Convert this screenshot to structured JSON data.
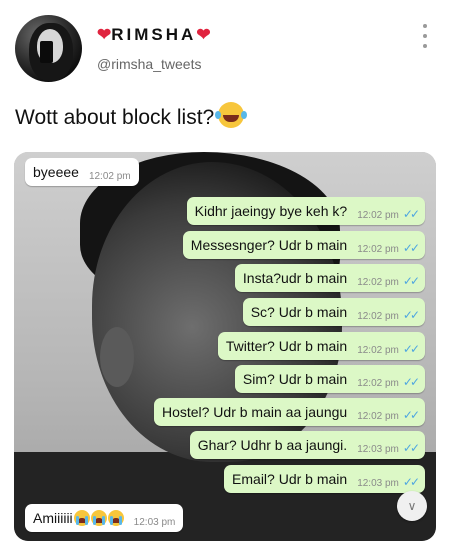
{
  "author": {
    "display_name": "RIMSHA",
    "handle": "@rimsha_tweets"
  },
  "tweet": {
    "text": "Wott about block list?",
    "emoji": "face-with-tears-of-joy"
  },
  "chat": {
    "messages": [
      {
        "side": "in",
        "text": "byeeee",
        "time": "12:02 pm"
      },
      {
        "side": "out",
        "text": "Kidhr jaeingy bye keh k?",
        "time": "12:02 pm",
        "ticks": "✓✓"
      },
      {
        "side": "out",
        "text": "Messesnger? Udr b main",
        "time": "12:02 pm",
        "ticks": "✓✓"
      },
      {
        "side": "out",
        "text": "Insta?udr b main",
        "time": "12:02 pm",
        "ticks": "✓✓"
      },
      {
        "side": "out",
        "text": "Sc? Udr b main",
        "time": "12:02 pm",
        "ticks": "✓✓"
      },
      {
        "side": "out",
        "text": "Twitter? Udr b main",
        "time": "12:02 pm",
        "ticks": "✓✓"
      },
      {
        "side": "out",
        "text": "Sim? Udr b main",
        "time": "12:02 pm",
        "ticks": "✓✓"
      },
      {
        "side": "out",
        "text": "Hostel? Udr b main aa jaungu",
        "time": "12:02 pm",
        "ticks": "✓✓"
      },
      {
        "side": "out",
        "text": "Ghar? Udhr b aa jaungi.",
        "time": "12:03 pm",
        "ticks": "✓✓"
      },
      {
        "side": "out",
        "text": "Email? Udr b main",
        "time": "12:03 pm",
        "ticks": "✓✓"
      },
      {
        "side": "in",
        "text": "Amiiiiii",
        "time": "12:03 pm",
        "emoji": "crying-face"
      }
    ],
    "scroll_icon": "double-chevron-down-icon",
    "read_tick_color": "#4fa6e0",
    "outgoing_bubble_color": "#dcf8c6"
  },
  "colors": {
    "heart": "#e0243f"
  }
}
